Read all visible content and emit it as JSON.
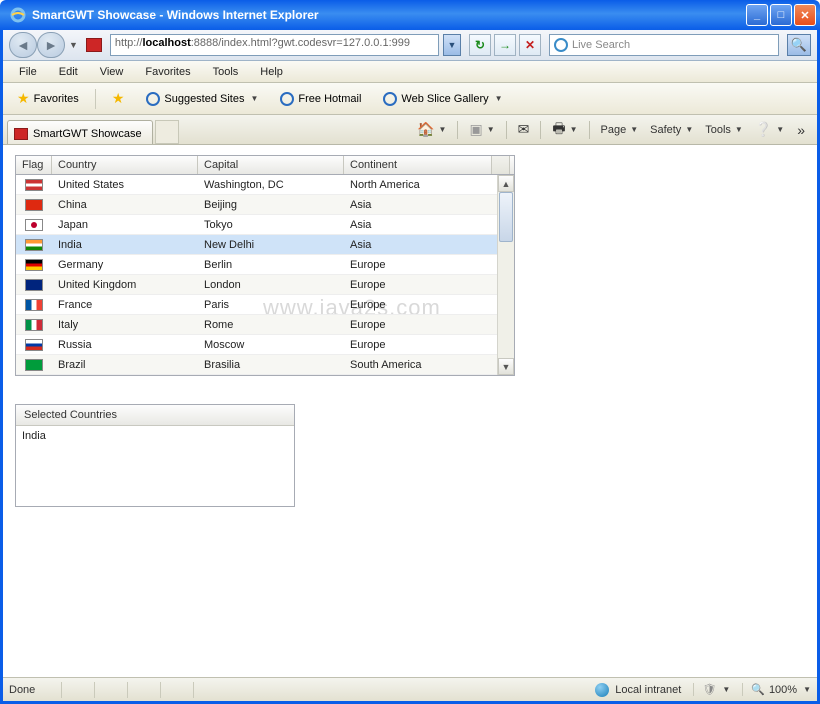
{
  "window": {
    "title": "SmartGWT Showcase - Windows Internet Explorer"
  },
  "address": {
    "prefix": "http://",
    "host": "localhost",
    "rest": ":8888/index.html?gwt.codesvr=127.0.0.1:999"
  },
  "search": {
    "placeholder": "Live Search"
  },
  "menus": {
    "file": "File",
    "edit": "Edit",
    "view": "View",
    "favorites": "Favorites",
    "tools": "Tools",
    "help": "Help"
  },
  "favbar": {
    "favorites": "Favorites",
    "suggested": "Suggested Sites",
    "hotmail": "Free Hotmail",
    "webslice": "Web Slice Gallery"
  },
  "tab": {
    "title": "SmartGWT Showcase"
  },
  "commandbar": {
    "page": "Page",
    "safety": "Safety",
    "tools": "Tools"
  },
  "grid": {
    "headers": {
      "flag": "Flag",
      "country": "Country",
      "capital": "Capital",
      "continent": "Continent"
    },
    "rows": [
      {
        "flagClass": "flag-us",
        "country": "United States",
        "capital": "Washington, DC",
        "continent": "North America",
        "selected": false
      },
      {
        "flagClass": "flag-cn",
        "country": "China",
        "capital": "Beijing",
        "continent": "Asia",
        "selected": false
      },
      {
        "flagClass": "flag-jp",
        "country": "Japan",
        "capital": "Tokyo",
        "continent": "Asia",
        "selected": false
      },
      {
        "flagClass": "flag-in",
        "country": "India",
        "capital": "New Delhi",
        "continent": "Asia",
        "selected": true
      },
      {
        "flagClass": "flag-de",
        "country": "Germany",
        "capital": "Berlin",
        "continent": "Europe",
        "selected": false
      },
      {
        "flagClass": "flag-uk",
        "country": "United Kingdom",
        "capital": "London",
        "continent": "Europe",
        "selected": false
      },
      {
        "flagClass": "flag-fr",
        "country": "France",
        "capital": "Paris",
        "continent": "Europe",
        "selected": false
      },
      {
        "flagClass": "flag-it",
        "country": "Italy",
        "capital": "Rome",
        "continent": "Europe",
        "selected": false
      },
      {
        "flagClass": "flag-ru",
        "country": "Russia",
        "capital": "Moscow",
        "continent": "Europe",
        "selected": false
      },
      {
        "flagClass": "flag-br",
        "country": "Brazil",
        "capital": "Brasilia",
        "continent": "South America",
        "selected": false
      }
    ]
  },
  "selectedPanel": {
    "title": "Selected Countries",
    "value": "India"
  },
  "watermark": "www.java2s.com",
  "statusbar": {
    "done": "Done",
    "zone": "Local intranet",
    "zoom": "100%"
  }
}
